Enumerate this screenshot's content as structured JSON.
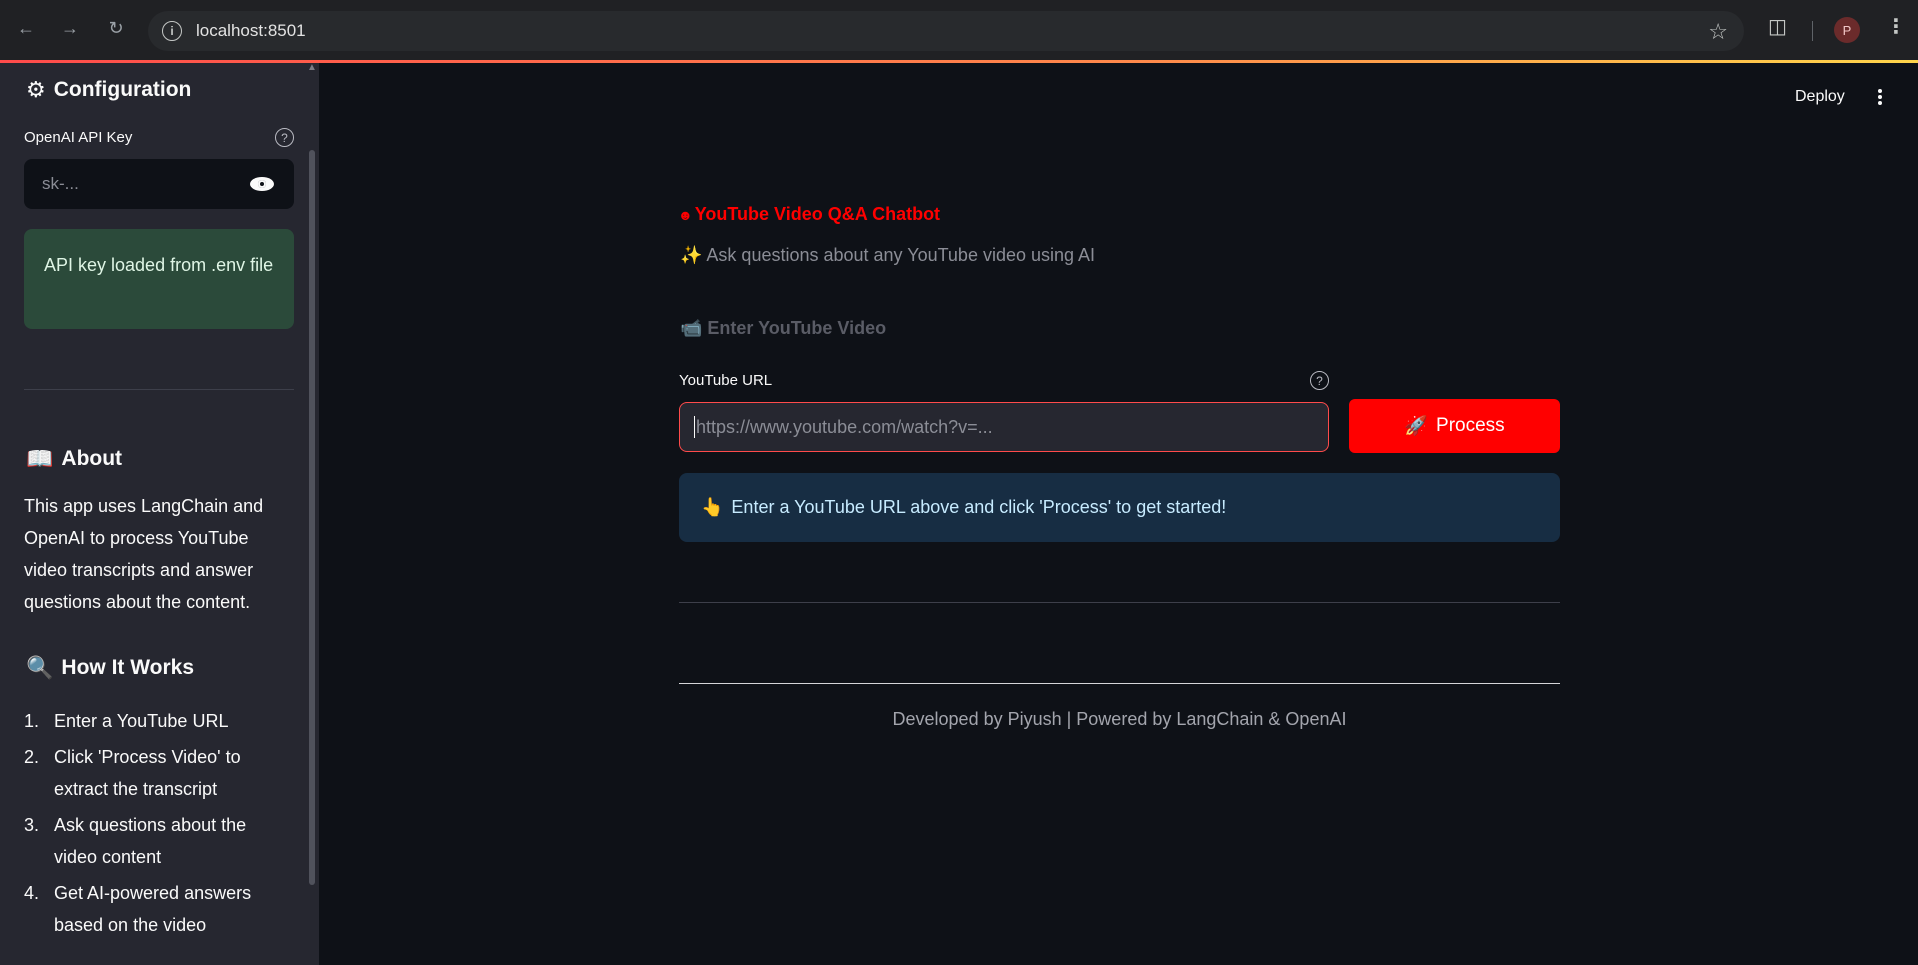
{
  "browser": {
    "url": "localhost:8501",
    "profile_initial": "P"
  },
  "sidebar": {
    "config_heading": "Configuration",
    "api_key_label": "OpenAI API Key",
    "api_key_placeholder": "sk-...",
    "success_message": "API key loaded from .env file",
    "about_heading": "About",
    "about_text": "This app uses LangChain and OpenAI to process YouTube video transcripts and answer questions about the content.",
    "how_heading": "How It Works",
    "steps": [
      {
        "num": "1.",
        "text": "Enter a YouTube URL"
      },
      {
        "num": "2.",
        "text": "Click 'Process Video' to extract the transcript"
      },
      {
        "num": "3.",
        "text": "Ask questions about the video content"
      },
      {
        "num": "4.",
        "text": "Get AI-powered answers based on the video"
      }
    ]
  },
  "header": {
    "deploy_label": "Deploy"
  },
  "main": {
    "title": "YouTube Video Q&A Chatbot",
    "subtitle": "✨ Ask questions about any YouTube video using AI",
    "section_heading": "📹 Enter YouTube Video",
    "url_label": "YouTube URL",
    "url_placeholder": "https://www.youtube.com/watch?v=...",
    "process_label": "Process",
    "info_message": "Enter a YouTube URL above and click 'Process' to get started!",
    "footer": "Developed by Piyush | Powered by LangChain & OpenAI"
  }
}
